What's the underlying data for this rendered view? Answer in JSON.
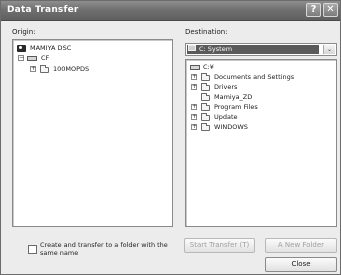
{
  "window": {
    "title": "Data Transfer"
  },
  "titlebar": {
    "help_glyph": "?",
    "close_glyph": "✕"
  },
  "origin": {
    "label": "Origin:",
    "tree": [
      {
        "label": "MAMIYA DSC",
        "icon": "camera-icon",
        "expander": ""
      },
      {
        "label": "CF",
        "icon": "drive-icon",
        "expander": "−"
      },
      {
        "label": "100MOPDS",
        "icon": "folder-icon",
        "expander": "+"
      }
    ]
  },
  "destination": {
    "label": "Destination:",
    "combo_value": "C: System",
    "combo_arrow": "⌄",
    "tree": [
      {
        "label": "C:¥",
        "icon": "drive-icon",
        "expander": ""
      },
      {
        "label": "Documents and Settings",
        "icon": "folder-icon",
        "expander": "+"
      },
      {
        "label": "Drivers",
        "icon": "folder-icon",
        "expander": "+"
      },
      {
        "label": "Mamiya_ZD",
        "icon": "folder-icon",
        "expander": ""
      },
      {
        "label": "Program Files",
        "icon": "folder-icon",
        "expander": "+"
      },
      {
        "label": "Update",
        "icon": "folder-icon",
        "expander": "+"
      },
      {
        "label": "WINDOWS",
        "icon": "folder-icon",
        "expander": "+"
      }
    ]
  },
  "options": {
    "create_folder_label": "Create and transfer to a folder with the same name",
    "create_folder_checked": false
  },
  "buttons": {
    "start_transfer": "Start Transfer (T)",
    "new_folder": "A New Folder",
    "close": "Close"
  }
}
